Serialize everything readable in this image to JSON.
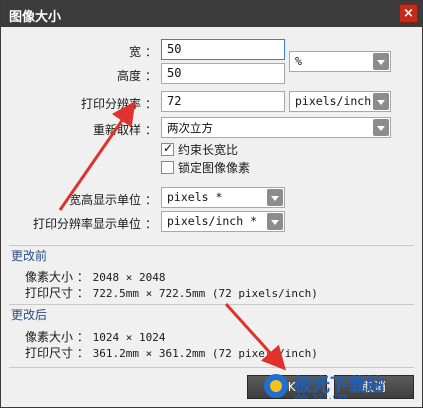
{
  "window": {
    "title": "图像大小",
    "close_glyph": "×"
  },
  "size": {
    "width_label": "宽",
    "width_value": "50",
    "height_label": "高度",
    "height_value": "50",
    "unit_value": "%",
    "colon": "："
  },
  "resolution": {
    "label": "打印分辨率",
    "value": "72",
    "unit_value": "pixels/inch"
  },
  "resample": {
    "label": "重新取样",
    "value": "两次立方",
    "constrain_label": "约束长宽比",
    "constrain_checked": true,
    "lock_label": "锁定图像像素",
    "lock_checked": false
  },
  "display_units": {
    "wh_label": "宽高显示单位",
    "wh_value": "pixels *",
    "res_label": "打印分辨率显示单位",
    "res_value": "pixels/inch *"
  },
  "before": {
    "title": "更改前",
    "pixel_label": "像素大小 ：",
    "pixel_value": "2048 × 2048",
    "print_label": "打印尺寸 ：",
    "print_value": "722.5mm × 722.5mm (72 pixels/inch)"
  },
  "after": {
    "title": "更改后",
    "pixel_label": "像素大小 ：",
    "pixel_value": "1024 × 1024",
    "print_label": "打印尺寸 ：",
    "print_value": "361.2mm × 361.2mm (72 pixels/inch)"
  },
  "buttons": {
    "ok": "OK",
    "cancel": "取消"
  },
  "watermark": {
    "text": "极光下载站",
    "url": "www.xz7.com"
  },
  "colors": {
    "annotation_arrow": "#e0322c",
    "title_bar": "#3c3c3c",
    "dialog_bg": "#f0f0f0"
  }
}
